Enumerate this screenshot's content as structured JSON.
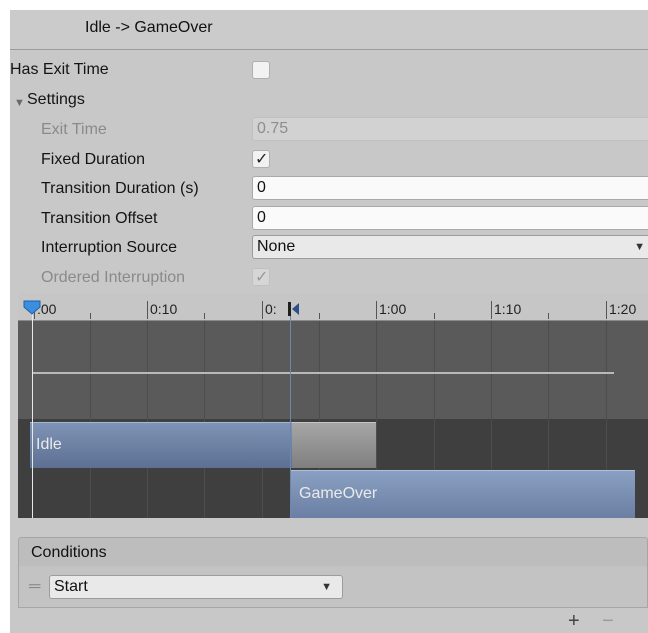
{
  "header": {
    "title": "Idle -> GameOver"
  },
  "properties": {
    "has_exit_time": {
      "label": "Has Exit Time",
      "checked": false
    },
    "settings": {
      "label": "Settings",
      "expanded": true
    },
    "exit_time": {
      "label": "Exit Time",
      "value": "0.75",
      "disabled": true
    },
    "fixed_duration": {
      "label": "Fixed Duration",
      "checked": true,
      "check_glyph": "✓"
    },
    "transition_duration": {
      "label": "Transition Duration (s)",
      "value": "0"
    },
    "transition_offset": {
      "label": "Transition Offset",
      "value": "0"
    },
    "interruption_source": {
      "label": "Interruption Source",
      "value": "None"
    },
    "ordered_interruption": {
      "label": "Ordered Interruption",
      "checked": true,
      "disabled": true,
      "check_glyph": "✓"
    }
  },
  "timeline": {
    "ticks": [
      "0:00",
      "0:10",
      "0:20",
      "1:00",
      "1:10",
      "1:20"
    ],
    "tick_label_visible": [
      ":00",
      "0:10",
      "0:",
      "1:00",
      "1:10",
      "1:20"
    ],
    "clips": [
      {
        "name": "Idle"
      },
      {
        "name": "GameOver"
      }
    ],
    "colors": {
      "clip_blue": "#6a7fa3",
      "playhead_marker": "#3b8fe0"
    }
  },
  "conditions": {
    "title": "Conditions",
    "items": [
      {
        "parameter": "Start"
      }
    ],
    "add_label": "+",
    "remove_label": "−"
  },
  "icons": {
    "foldout": "triangle-down-icon",
    "dropdown": "chevron-down-icon",
    "drag": "drag-handle-icon"
  }
}
